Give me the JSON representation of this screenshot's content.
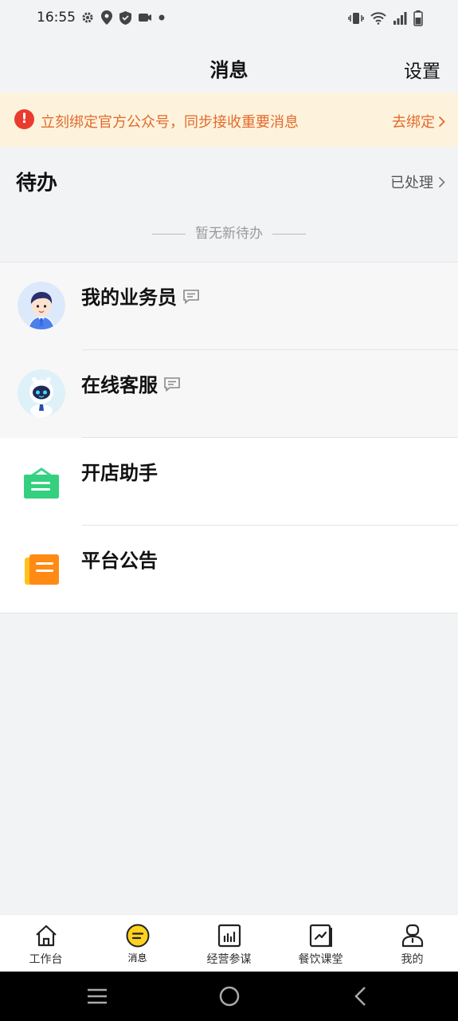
{
  "status_bar": {
    "time": "16:55"
  },
  "header": {
    "title": "消息",
    "settings_label": "设置"
  },
  "banner": {
    "text": "立刻绑定官方公众号，同步接收重要消息",
    "action_label": "去绑定",
    "accent_color": "#e46a2c"
  },
  "todo": {
    "title": "待办",
    "processed_label": "已处理",
    "empty_text": "暂无新待办"
  },
  "messages": [
    {
      "label": "我的业务员",
      "icon": "salesman-avatar",
      "has_chat_badge": true
    },
    {
      "label": "在线客服",
      "icon": "robot-avatar",
      "has_chat_badge": true
    },
    {
      "label": "开店助手",
      "icon": "shop-bag-icon",
      "has_chat_badge": false
    },
    {
      "label": "平台公告",
      "icon": "notice-book-icon",
      "has_chat_badge": false
    }
  ],
  "tabbar": {
    "items": [
      {
        "label": "工作台",
        "icon": "home-icon"
      },
      {
        "label": "消息",
        "icon": "message-icon",
        "active": true
      },
      {
        "label": "经营参谋",
        "icon": "bar-chart-icon"
      },
      {
        "label": "餐饮课堂",
        "icon": "trend-book-icon"
      },
      {
        "label": "我的",
        "icon": "person-icon"
      }
    ],
    "active_color": "#ffd21e"
  }
}
